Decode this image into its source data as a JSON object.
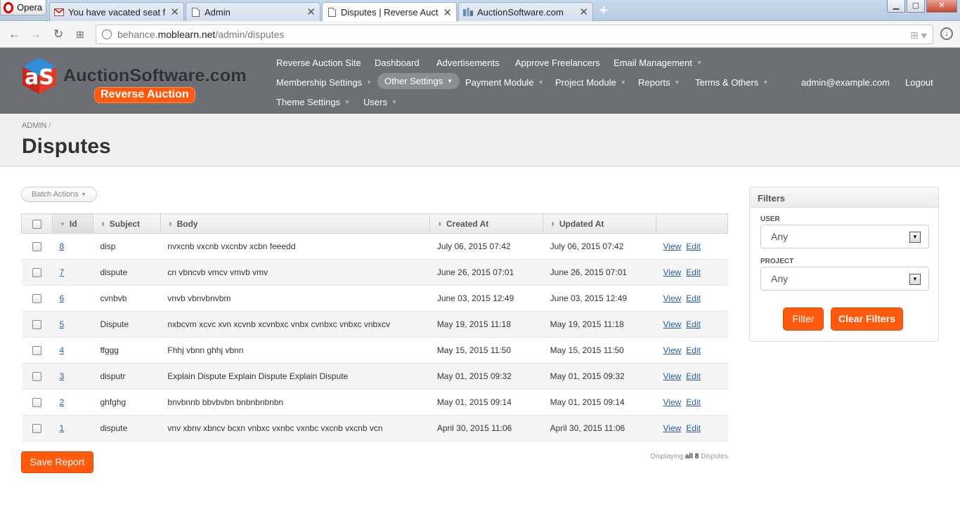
{
  "browser": {
    "menu_label": "Opera",
    "tabs": [
      {
        "title": "You have vacated seat fro",
        "favicon": "gmail-icon"
      },
      {
        "title": "Admin",
        "favicon": "page-icon"
      },
      {
        "title": "Disputes | Reverse Auction",
        "favicon": "page-icon",
        "active": true
      },
      {
        "title": "AuctionSoftware.com",
        "favicon": "site-icon"
      }
    ],
    "url_prefix": "behance.",
    "url_domain": "moblearn.net",
    "url_path": "/admin/disputes"
  },
  "site": {
    "logo_name": "AuctionSoftware.com",
    "logo_tag": "Reverse Auction",
    "nav": {
      "reverse_auction_site": "Reverse Auction Site",
      "dashboard": "Dashboard",
      "advertisements": "Advertisements",
      "approve_freelancers": "Approve Freelancers",
      "email_management": "Email Management",
      "membership_settings": "Membership Settings",
      "other_settings": "Other Settings",
      "payment_module": "Payment Module",
      "project_module": "Project Module",
      "reports": "Reports",
      "terms_others": "Terms & Others",
      "user_email": "admin@example.com",
      "logout": "Logout",
      "theme_settings": "Theme Settings",
      "users": "Users"
    }
  },
  "page": {
    "breadcrumb": "ADMIN",
    "breadcrumb_sep": "/",
    "title": "Disputes"
  },
  "grid": {
    "batch_actions": "Batch Actions",
    "columns": {
      "id": "Id",
      "subject": "Subject",
      "body": "Body",
      "created_at": "Created At",
      "updated_at": "Updated At"
    },
    "view_label": "View",
    "edit_label": "Edit",
    "rows": [
      {
        "id": "8",
        "subject": "disp",
        "body": "nvxcnb vxcnb vxcnbv xcbn feeedd",
        "created": "July 06, 2015 07:42",
        "updated": "July 06, 2015 07:42"
      },
      {
        "id": "7",
        "subject": "dispute",
        "body": "cn vbncvb vmcv vmvb vmv",
        "created": "June 26, 2015 07:01",
        "updated": "June 26, 2015 07:01"
      },
      {
        "id": "6",
        "subject": "cvnbvb",
        "body": "vnvb vbnvbnvbm",
        "created": "June 03, 2015 12:49",
        "updated": "June 03, 2015 12:49"
      },
      {
        "id": "5",
        "subject": "Dispute",
        "body": "nxbcvm xcvc xvn xcvnb xcvnbxc vnbx cvnbxc vnbxc vnbxcv",
        "created": "May 19, 2015 11:18",
        "updated": "May 19, 2015 11:18"
      },
      {
        "id": "4",
        "subject": "ffggg",
        "body": "Fhhj vbnn ghhj vbnn",
        "created": "May 15, 2015 11:50",
        "updated": "May 15, 2015 11:50"
      },
      {
        "id": "3",
        "subject": "disputr",
        "body": "Explain Dispute Explain Dispute Explain Dispute",
        "created": "May 01, 2015 09:32",
        "updated": "May 01, 2015 09:32"
      },
      {
        "id": "2",
        "subject": "ghfghg",
        "body": "bnvbnnb bbvbvbn bnbnbnbnbn",
        "created": "May 01, 2015 09:14",
        "updated": "May 01, 2015 09:14"
      },
      {
        "id": "1",
        "subject": "dispute",
        "body": "vnv xbnv xbncv bcxn vnbxc vxnbc vxnbc vxcnb vxcnb vcn",
        "created": "April 30, 2015 11:06",
        "updated": "April 30, 2015 11:06"
      }
    ],
    "save_report": "Save Report",
    "display_prefix": "Displaying",
    "display_all": "all 8",
    "display_suffix": "Disputes"
  },
  "filters": {
    "title": "Filters",
    "user_label": "USER",
    "user_value": "Any",
    "project_label": "PROJECT",
    "project_value": "Any",
    "filter_button": "Filter",
    "clear_button": "Clear Filters"
  },
  "colors": {
    "accent": "#ff5a0d",
    "header_bg": "#6c6f73",
    "link": "#2a5b9c"
  }
}
